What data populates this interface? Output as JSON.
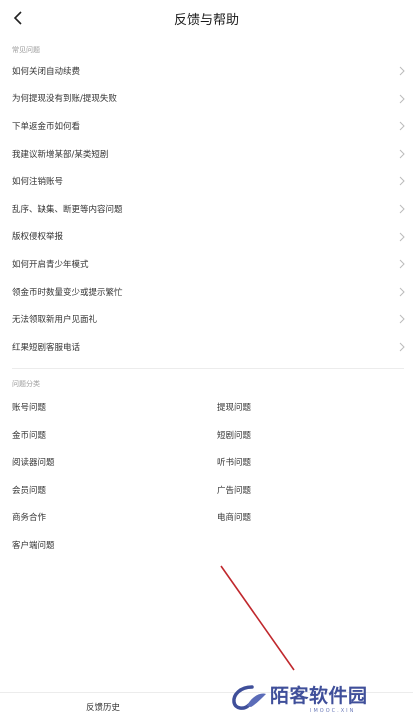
{
  "header": {
    "title": "反馈与帮助"
  },
  "faq": {
    "section_label": "常见问题",
    "items": [
      "如何关闭自动续费",
      "为何提现没有到账/提现失败",
      "下单返金币如何看",
      "我建议新增某部/某类短剧",
      "如何注销账号",
      "乱序、缺集、断更等内容问题",
      "版权侵权举报",
      "如何开启青少年模式",
      "领金币时数量变少或提示繁忙",
      "无法领取新用户见面礼",
      "红果短剧客服电话"
    ]
  },
  "categories": {
    "section_label": "问题分类",
    "items": [
      "账号问题",
      "提现问题",
      "金币问题",
      "短剧问题",
      "阅读器问题",
      "听书问题",
      "会员问题",
      "广告问题",
      "商务合作",
      "电商问题",
      "客户端问题"
    ]
  },
  "bottom": {
    "history_label": "反馈历史"
  },
  "watermark": {
    "text": "陌客软件园",
    "sub": "IMOOC.XIN"
  },
  "colors": {
    "annotation_arrow": "#c0282d",
    "watermark": "#3f4f9a"
  }
}
